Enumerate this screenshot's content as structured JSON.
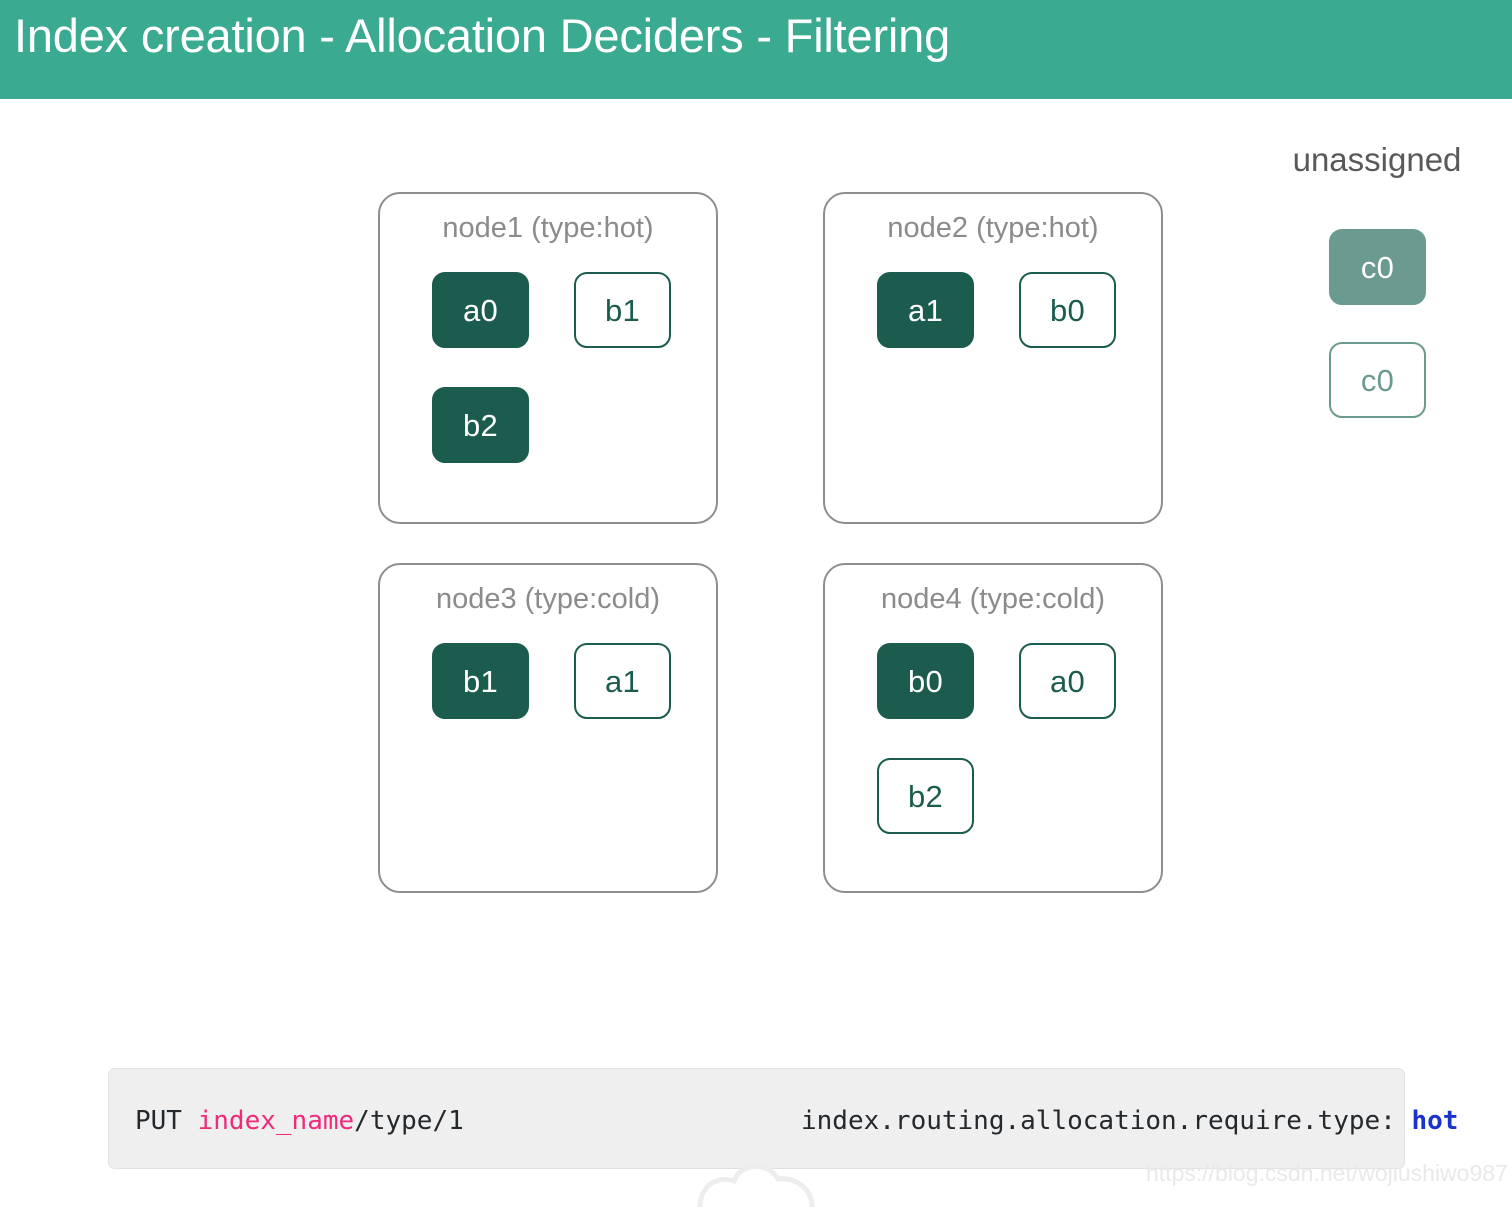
{
  "header": {
    "title": "Index creation - Allocation Deciders - Filtering",
    "background_color": "#3aaa91",
    "text_color": "#ffffff"
  },
  "colors": {
    "accent_teal": "#3aaa91",
    "primary_shard_fill": "#1b5c4f",
    "replica_shard_border": "#1b5c4f",
    "unassigned_shard_fill": "#6b9a90",
    "node_border": "#8e8e8e",
    "node_label": "#8b8b8b",
    "code_background": "#efefef",
    "code_pink": "#f02a7b",
    "code_blue": "#1a33cc"
  },
  "diagram": {
    "nodes": [
      {
        "id": "node1",
        "label": "node1 (type:hot)",
        "shards": [
          {
            "label": "a0",
            "kind": "primary",
            "slot": "r0c0"
          },
          {
            "label": "b1",
            "kind": "replica",
            "slot": "r0c1"
          },
          {
            "label": "b2",
            "kind": "primary",
            "slot": "r1c0"
          }
        ]
      },
      {
        "id": "node2",
        "label": "node2 (type:hot)",
        "shards": [
          {
            "label": "a1",
            "kind": "primary",
            "slot": "r0c0"
          },
          {
            "label": "b0",
            "kind": "replica",
            "slot": "r0c1"
          }
        ]
      },
      {
        "id": "node3",
        "label": "node3 (type:cold)",
        "shards": [
          {
            "label": "b1",
            "kind": "primary",
            "slot": "r0c0"
          },
          {
            "label": "a1",
            "kind": "replica",
            "slot": "r0c1"
          }
        ]
      },
      {
        "id": "node4",
        "label": "node4 (type:cold)",
        "shards": [
          {
            "label": "b0",
            "kind": "primary",
            "slot": "r0c0"
          },
          {
            "label": "a0",
            "kind": "replica",
            "slot": "r0c1"
          },
          {
            "label": "b2",
            "kind": "replica",
            "slot": "r1c0"
          }
        ]
      }
    ],
    "unassigned": {
      "label": "unassigned",
      "shards": [
        {
          "label": "c0",
          "kind": "unassigned-primary"
        },
        {
          "label": "c0",
          "kind": "unassigned-replica"
        }
      ]
    }
  },
  "code": {
    "left": {
      "method": "PUT ",
      "index": "index_name",
      "path": "/type/1"
    },
    "right": {
      "setting": "index.routing.allocation.require.type: ",
      "value": "hot"
    }
  },
  "watermark": {
    "url": "https://blog.csdn.net/wojiushiwo987"
  }
}
